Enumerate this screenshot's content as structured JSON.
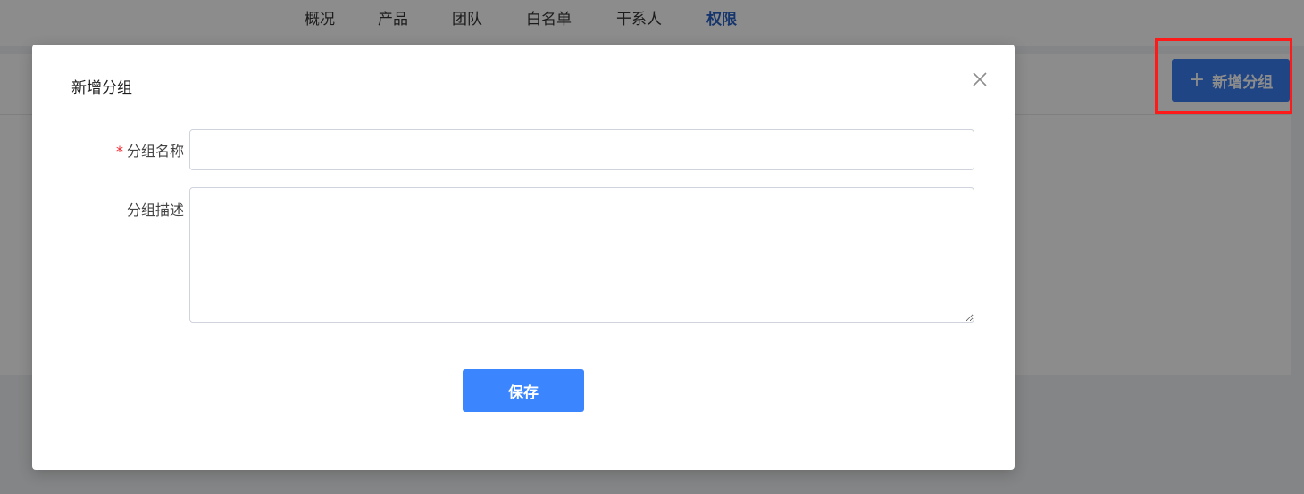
{
  "nav": {
    "tabs": [
      {
        "label": "概况",
        "active": false
      },
      {
        "label": "产品",
        "active": false
      },
      {
        "label": "团队",
        "active": false
      },
      {
        "label": "白名单",
        "active": false
      },
      {
        "label": "干系人",
        "active": false
      },
      {
        "label": "权限",
        "active": true
      }
    ]
  },
  "toolbar": {
    "add_group_label": "新增分组",
    "add_group_icon": "plus-icon"
  },
  "modal": {
    "title": "新增分组",
    "close_icon": "close-icon",
    "fields": {
      "group_name": {
        "label": "分组名称",
        "required": true,
        "value": "",
        "placeholder": ""
      },
      "group_description": {
        "label": "分组描述",
        "required": false,
        "value": "",
        "placeholder": ""
      }
    },
    "save_label": "保存"
  },
  "colors": {
    "primary": "#3b86ff",
    "active_tab": "#2a62c6",
    "required_star": "#f5222d",
    "highlight": "#ff1a1a"
  }
}
